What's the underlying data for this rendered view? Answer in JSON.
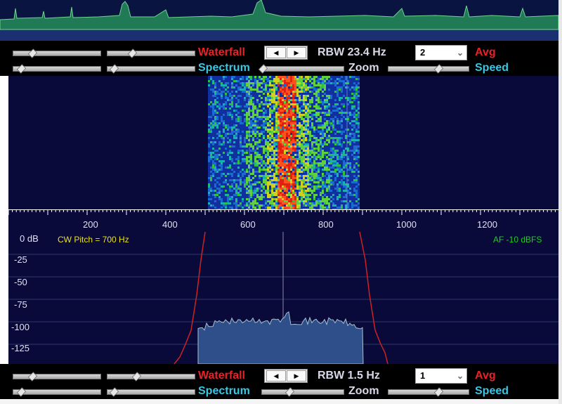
{
  "top_panel": {
    "waterfall_label": "Waterfall",
    "spectrum_label": "Spectrum",
    "rbw_label": "RBW 23.4 Hz",
    "avg_value": "2",
    "avg_label": "Avg",
    "zoom_label": "Zoom",
    "speed_label": "Speed",
    "arrow_left": "◀",
    "arrow_right": "▶"
  },
  "bottom_panel": {
    "waterfall_label": "Waterfall",
    "spectrum_label": "Spectrum",
    "rbw_label": "RBW  1.5 Hz",
    "avg_value": "1",
    "avg_label": "Avg",
    "zoom_label": "Zoom",
    "speed_label": "Speed",
    "arrow_left": "◀",
    "arrow_right": "▶"
  },
  "spectrum": {
    "cw_pitch": "CW Pitch = 700 Hz",
    "af_level": "AF -10 dBFS",
    "db_labels": [
      "0 dB",
      "-25",
      "-50",
      "-75",
      "-100",
      "-125"
    ]
  },
  "frequency_axis": {
    "ticks": [
      "200",
      "400",
      "600",
      "800",
      "1000",
      "1200"
    ]
  },
  "colors": {
    "red_label": "#e8222a",
    "cyan_label": "#36c8e6",
    "background": "#0a0a3a",
    "filter_curve": "#cc2222",
    "cw_pitch_text": "#e8e020",
    "af_text": "#22cc22"
  }
}
